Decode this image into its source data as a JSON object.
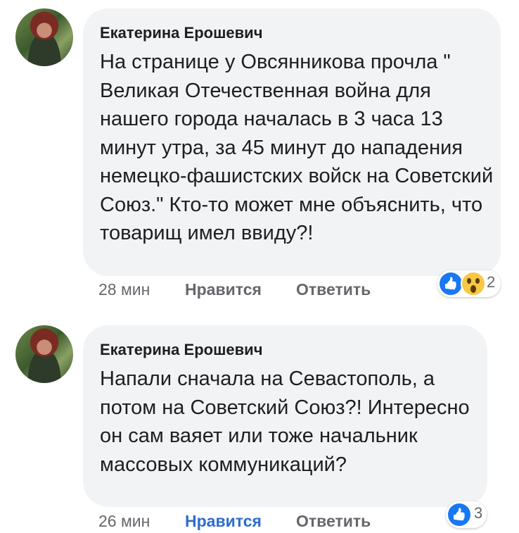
{
  "comments": [
    {
      "author": "Екатерина Ерошевич",
      "text": "На странице у Овсянникова прочла \" Великая Отечественная война для нашего города началась в 3 часа 13 минут утра, за 45 минут до нападения немецко-фашистских войск на Советский Союз.\" Кто-то может мне объяснить, что товарищ имел ввиду?!",
      "time": "28 мин",
      "like_label": "Нравится",
      "liked": false,
      "reply_label": "Ответить",
      "reactions": [
        "like-icon",
        "wow-icon"
      ],
      "reaction_count": "2"
    },
    {
      "author": "Екатерина Ерошевич",
      "text": "Напали сначала на Севастополь, а потом на Советский Союз?! Интересно он сам ваяет или тоже начальник массовых коммуникаций?",
      "time": "26 мин",
      "like_label": "Нравится",
      "liked": true,
      "reply_label": "Ответить",
      "reactions": [
        "like-icon"
      ],
      "reaction_count": "3"
    }
  ],
  "colors": {
    "bubble": "#f2f3f5",
    "like_active": "#2d6ccf",
    "meta": "#65676b",
    "like_reaction": "#1877f2",
    "wow_reaction": "#f7c843"
  }
}
